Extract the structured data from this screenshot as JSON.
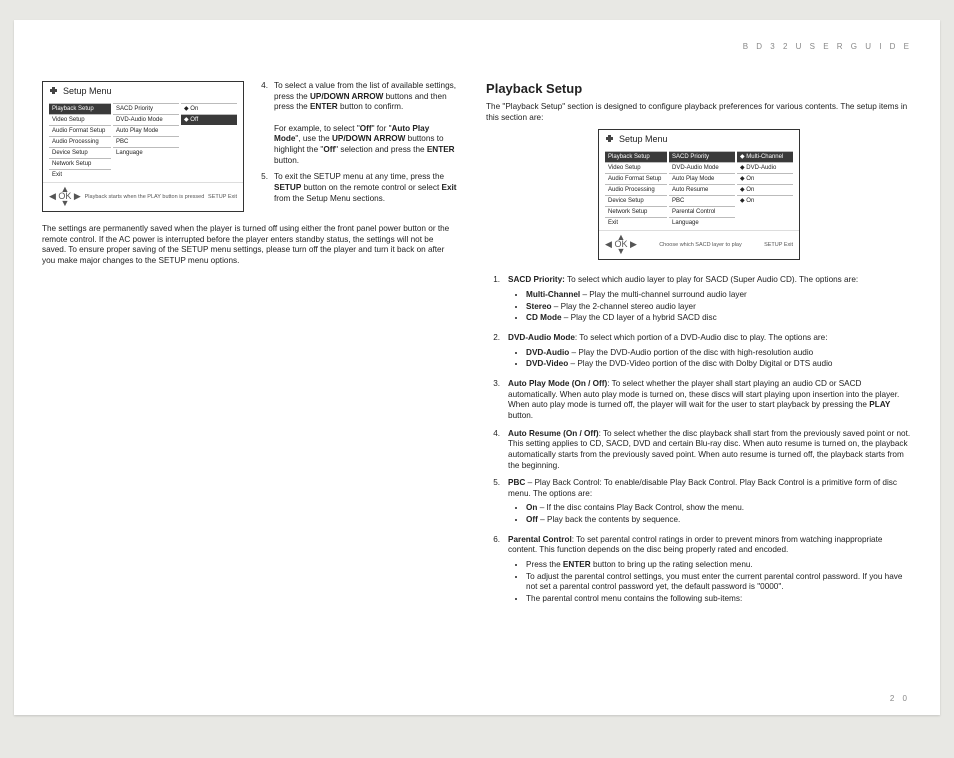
{
  "header": "B D 3 2   U S E R   G U I D E",
  "page_number": "2 0",
  "left": {
    "setup_title": "Setup Menu",
    "col1": [
      "Playback Setup",
      "Video Setup",
      "Audio Format Setup",
      "Audio Processing",
      "Device Setup",
      "Network Setup",
      "Exit"
    ],
    "col2": [
      "SACD Priority",
      "DVD-Audio Mode",
      "Auto Play Mode",
      "PBC",
      "Language"
    ],
    "col3": [
      "On",
      "Off"
    ],
    "footer_hint": "Playback starts when the PLAY button is pressed",
    "footer_right": "SETUP  Exit",
    "instr4_a": "To select a value from the list of available settings, press the ",
    "instr4_b": "UP/DOWN ARROW",
    "instr4_c": " buttons and then press the ",
    "instr4_d": "ENTER",
    "instr4_e": " button to confirm.",
    "instr4_ex_a": "For example, to select \"",
    "instr4_ex_b": "Off",
    "instr4_ex_c": "\" for \"",
    "instr4_ex_d": "Auto Play Mode",
    "instr4_ex_e": "\", use the ",
    "instr4_ex_f": "UP/DOWN ARROW",
    "instr4_ex_g": " buttons to highlight the \"",
    "instr4_ex_h": "Off",
    "instr4_ex_i": "\" selection and press the ",
    "instr4_ex_j": "ENTER",
    "instr4_ex_k": " button.",
    "instr5_a": "To exit the SETUP menu at any time, press the ",
    "instr5_b": "SETUP",
    "instr5_c": " button on the remote control or select ",
    "instr5_d": "Exit",
    "instr5_e": " from the Setup Menu sections.",
    "para": "The settings are permanently saved when the player is turned off using either the front panel power button or the remote control.  If the AC power is interrupted before the player enters standby status, the settings will not be saved.  To ensure proper saving of the SETUP menu settings, please turn off the player and turn it back on after you make major changes to the SETUP menu options."
  },
  "right": {
    "title": "Playback Setup",
    "intro": "The \"Playback Setup\" section is designed to configure playback preferences for various contents.  The setup items in this section are:",
    "setup_title": "Setup Menu",
    "col1": [
      "Playback Setup",
      "Video Setup",
      "Audio Format Setup",
      "Audio Processing",
      "Device Setup",
      "Network Setup",
      "Exit"
    ],
    "col2": [
      "SACD Priority",
      "DVD-Audio Mode",
      "Auto Play Mode",
      "Auto Resume",
      "PBC",
      "Parental Control",
      "Language"
    ],
    "col3": [
      "Multi-Channel",
      "DVD-Audio",
      "On",
      "On",
      "On"
    ],
    "footer_hint": "Choose which SACD layer to play",
    "footer_right": "SETUP  Exit",
    "items": [
      {
        "n": "1.",
        "lead": "SACD Priority:",
        "tail": " To select which audio layer to play for SACD (Super Audio CD).  The options are:",
        "bul": [
          {
            "b": "Multi-Channel",
            "t": " – Play the multi-channel surround audio layer"
          },
          {
            "b": "Stereo",
            "t": " – Play the 2-channel stereo audio layer"
          },
          {
            "b": "CD Mode",
            "t": " – Play the CD layer of a hybrid SACD disc"
          }
        ]
      },
      {
        "n": "2.",
        "lead": "DVD-Audio Mode",
        "tail": ": To select which portion of a DVD-Audio disc to play.  The options are:",
        "bul": [
          {
            "b": "DVD-Audio",
            "t": " – Play the DVD-Audio portion of the disc with high-resolution audio"
          },
          {
            "b": "DVD-Video",
            "t": " – Play the DVD-Video portion of the disc with Dolby Digital or DTS audio"
          }
        ]
      },
      {
        "n": "3.",
        "lead": "Auto Play Mode (On / Off)",
        "tail": ": To select whether the player shall start playing an audio CD or SACD automatically.  When auto play mode is turned on, these discs will start playing upon insertion into the player.  When auto play mode is turned off, the player will wait for the user to start playback by pressing the ",
        "tail_b": "PLAY",
        "tail_c": " button."
      },
      {
        "n": "4.",
        "lead": "Auto Resume (On / Off)",
        "tail": ": To select whether the disc playback shall start from the previously saved point or not.  This setting applies to CD, SACD, DVD and certain Blu-ray disc.  When auto resume is turned on, the playback automatically starts from the previously saved point. When auto resume is turned off, the playback starts from the beginning."
      },
      {
        "n": "5.",
        "lead": "PBC",
        "tail": " – Play Back Control:  To enable/disable Play Back Control.  Play Back Control is a primitive form of disc menu.  The options are:",
        "bul": [
          {
            "b": "On",
            "t": " – If the disc contains Play Back Control, show the menu."
          },
          {
            "b": "Off",
            "t": " – Play back the contents by sequence."
          }
        ]
      },
      {
        "n": "6.",
        "lead": "Parental Control",
        "tail": ": To set parental control ratings in order to prevent minors from watching inappropriate content.  This function depends on the disc being properly rated and encoded.",
        "bul": [
          {
            "b": "",
            "t": "Press the ",
            "b2": "ENTER",
            "t2": " button to bring up the rating selection menu."
          },
          {
            "b": "",
            "t": "To adjust the parental control settings, you must enter the current parental control password. If you have not set a parental control password yet, the default password is \"0000\"."
          },
          {
            "b": "",
            "t": "The parental control menu contains the following sub-items:"
          }
        ]
      }
    ]
  }
}
